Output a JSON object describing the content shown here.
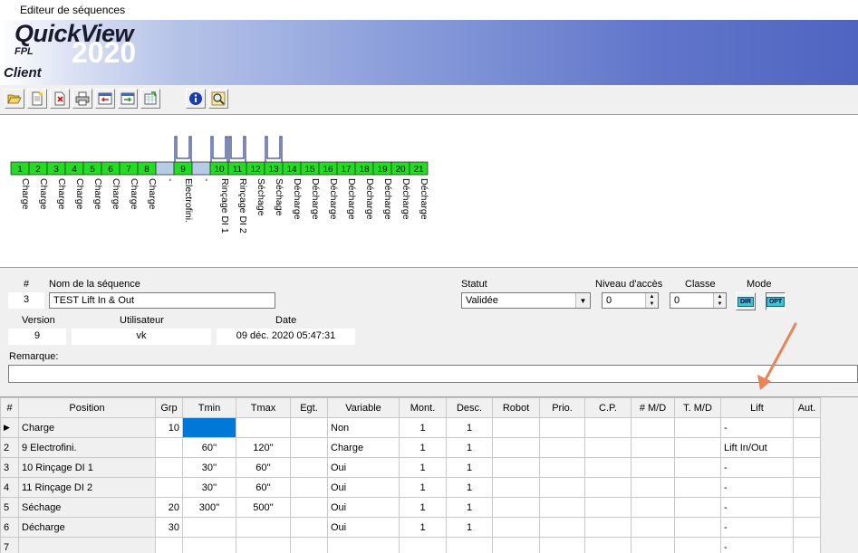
{
  "window": {
    "title": "Editeur de séquences"
  },
  "brand": {
    "name": "QuickView",
    "year": "2020",
    "sub": "FPL",
    "client": "Client"
  },
  "toolbar": {
    "buttons": [
      {
        "name": "open-folder-icon"
      },
      {
        "name": "new-document-icon"
      },
      {
        "name": "delete-document-icon"
      },
      {
        "name": "print-icon"
      },
      {
        "name": "import-icon"
      },
      {
        "name": "export-icon"
      },
      {
        "name": "export-excel-icon"
      },
      {
        "name": "info-icon"
      },
      {
        "name": "search-icon"
      }
    ]
  },
  "diagram": {
    "stations": [
      {
        "num": "1",
        "label": "Charge",
        "active": true,
        "dip": false
      },
      {
        "num": "2",
        "label": "Charge",
        "active": true,
        "dip": false
      },
      {
        "num": "3",
        "label": "Charge",
        "active": true,
        "dip": false
      },
      {
        "num": "4",
        "label": "Charge",
        "active": true,
        "dip": false
      },
      {
        "num": "5",
        "label": "Charge",
        "active": true,
        "dip": false
      },
      {
        "num": "6",
        "label": "Charge",
        "active": true,
        "dip": false
      },
      {
        "num": "7",
        "label": "Charge",
        "active": true,
        "dip": false
      },
      {
        "num": "8",
        "label": "Charge",
        "active": true,
        "dip": false
      },
      {
        "num": "",
        "label": "-",
        "active": false,
        "dip": false
      },
      {
        "num": "9",
        "label": "Electrofini.",
        "active": true,
        "dip": true
      },
      {
        "num": "",
        "label": "-",
        "active": false,
        "dip": false
      },
      {
        "num": "10",
        "label": "Rinçage DI 1",
        "active": true,
        "dip": true
      },
      {
        "num": "11",
        "label": "Rinçage DI 2",
        "active": true,
        "dip": true
      },
      {
        "num": "12",
        "label": "Séchage",
        "active": true,
        "dip": false
      },
      {
        "num": "13",
        "label": "Séchage",
        "active": true,
        "dip": true
      },
      {
        "num": "14",
        "label": "Décharge",
        "active": true,
        "dip": false
      },
      {
        "num": "15",
        "label": "Décharge",
        "active": true,
        "dip": false
      },
      {
        "num": "16",
        "label": "Décharge",
        "active": true,
        "dip": false
      },
      {
        "num": "17",
        "label": "Décharge",
        "active": true,
        "dip": false
      },
      {
        "num": "18",
        "label": "Décharge",
        "active": true,
        "dip": false
      },
      {
        "num": "19",
        "label": "Décharge",
        "active": true,
        "dip": false
      },
      {
        "num": "20",
        "label": "Décharge",
        "active": true,
        "dip": false
      },
      {
        "num": "21",
        "label": "Décharge",
        "active": true,
        "dip": false
      }
    ],
    "colors": {
      "active": "#22dd22",
      "inactive": "#b5cbe6",
      "dip": "#3b4a8c"
    }
  },
  "form": {
    "num_label": "#",
    "num_value": "3",
    "name_label": "Nom de la séquence",
    "name_value": "TEST Lift In & Out",
    "statut_label": "Statut",
    "statut_value": "Validée",
    "niveau_label": "Niveau d'accès",
    "niveau_value": "0",
    "classe_label": "Classe",
    "classe_value": "0",
    "mode_label": "Mode",
    "mode_btn1": "DIR",
    "mode_btn2": "OPT",
    "version_label": "Version",
    "version_value": "9",
    "user_label": "Utilisateur",
    "user_value": "vk",
    "date_label": "Date",
    "date_value": "09 déc. 2020 05:47:31",
    "remarque_label": "Remarque:",
    "remarque_value": ""
  },
  "table": {
    "headers": [
      "#",
      "Position",
      "Grp",
      "Tmin",
      "Tmax",
      "Egt.",
      "Variable",
      "Mont.",
      "Desc.",
      "Robot",
      "Prio.",
      "C.P.",
      "# M/D",
      "T. M/D",
      "Lift",
      "Aut."
    ],
    "rows": [
      {
        "num": "▶",
        "position": "Charge",
        "grp": "10",
        "tmin": "",
        "tmax": "",
        "egt": "",
        "variable": "Non",
        "mont": "1",
        "desc": "1",
        "robot": "",
        "prio": "",
        "cp": "",
        "nmd": "",
        "tmd": "",
        "lift": "-",
        "aut": ""
      },
      {
        "num": "2",
        "position": "9 Electrofini.",
        "grp": "",
        "tmin": "60''",
        "tmax": "120''",
        "egt": "",
        "variable": "Charge",
        "mont": "1",
        "desc": "1",
        "robot": "",
        "prio": "",
        "cp": "",
        "nmd": "",
        "tmd": "",
        "lift": "Lift In/Out",
        "aut": ""
      },
      {
        "num": "3",
        "position": "10 Rinçage DI 1",
        "grp": "",
        "tmin": "30''",
        "tmax": "60''",
        "egt": "",
        "variable": "Oui",
        "mont": "1",
        "desc": "1",
        "robot": "",
        "prio": "",
        "cp": "",
        "nmd": "",
        "tmd": "",
        "lift": "-",
        "aut": ""
      },
      {
        "num": "4",
        "position": "11 Rinçage DI 2",
        "grp": "",
        "tmin": "30''",
        "tmax": "60''",
        "egt": "",
        "variable": "Oui",
        "mont": "1",
        "desc": "1",
        "robot": "",
        "prio": "",
        "cp": "",
        "nmd": "",
        "tmd": "",
        "lift": "-",
        "aut": ""
      },
      {
        "num": "5",
        "position": "Séchage",
        "grp": "20",
        "tmin": "300''",
        "tmax": "500''",
        "egt": "",
        "variable": "Oui",
        "mont": "1",
        "desc": "1",
        "robot": "",
        "prio": "",
        "cp": "",
        "nmd": "",
        "tmd": "",
        "lift": "-",
        "aut": ""
      },
      {
        "num": "6",
        "position": "Décharge",
        "grp": "30",
        "tmin": "",
        "tmax": "",
        "egt": "",
        "variable": "Oui",
        "mont": "1",
        "desc": "1",
        "robot": "",
        "prio": "",
        "cp": "",
        "nmd": "",
        "tmd": "",
        "lift": "-",
        "aut": ""
      },
      {
        "num": "7",
        "position": "",
        "grp": "",
        "tmin": "",
        "tmax": "",
        "egt": "",
        "variable": "",
        "mont": "",
        "desc": "",
        "robot": "",
        "prio": "",
        "cp": "",
        "nmd": "",
        "tmd": "",
        "lift": "-",
        "aut": ""
      }
    ]
  },
  "accent": {
    "arrow": "#e8845a",
    "selection": "#0078d7"
  }
}
